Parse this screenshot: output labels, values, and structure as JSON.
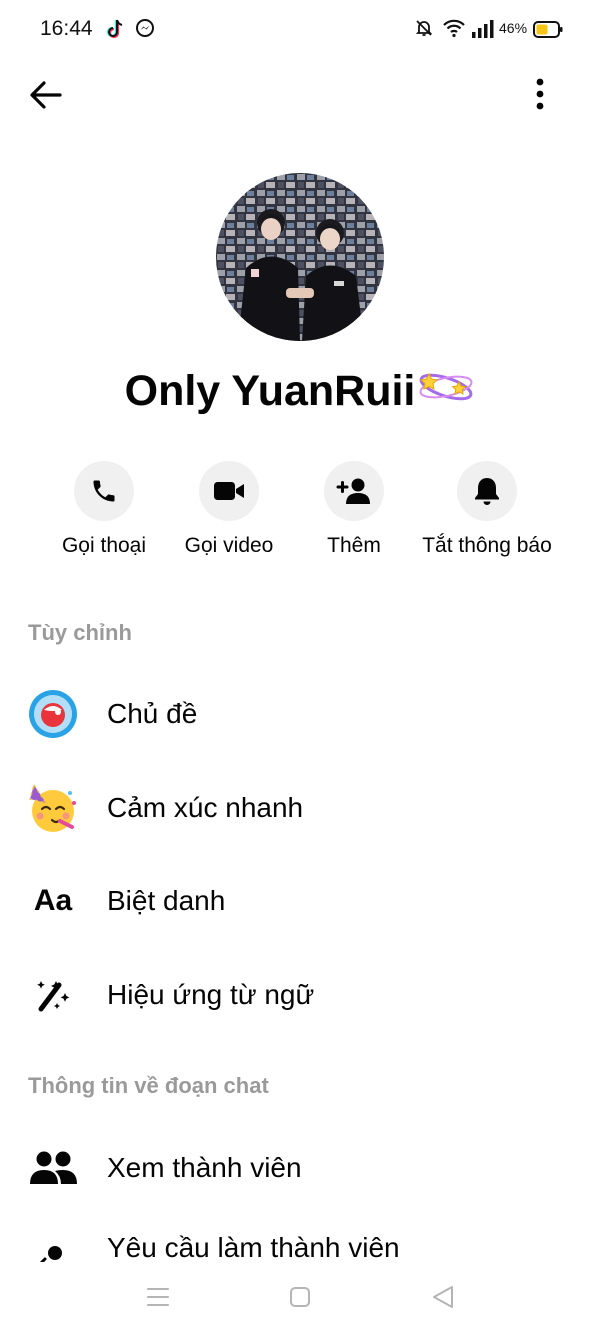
{
  "status_bar": {
    "time": "16:44",
    "battery_percent": "46%",
    "icons": [
      "tiktok-icon",
      "messenger-icon",
      "mute-bell-icon",
      "wifi-icon",
      "signal-icon",
      "battery-icon"
    ]
  },
  "header": {
    "back_icon": "arrow-left-icon",
    "more_icon": "more-vertical-icon"
  },
  "profile": {
    "name": "Only YuanRuii",
    "name_decoration": "sparkle-planet-emoji"
  },
  "actions": [
    {
      "label": "Gọi thoại",
      "icon": "phone-icon"
    },
    {
      "label": "Gọi video",
      "icon": "video-camera-icon"
    },
    {
      "label": "Thêm",
      "icon": "add-person-icon"
    },
    {
      "label": "Tắt thông báo",
      "icon": "bell-icon"
    }
  ],
  "customize_section": {
    "title": "Tùy chỉnh",
    "items": [
      {
        "label": "Chủ đề",
        "icon": "theme-icon"
      },
      {
        "label": "Cảm xúc nhanh",
        "icon": "party-face-emoji-icon"
      },
      {
        "label": "Biệt danh",
        "icon": "nickname-aa-icon"
      },
      {
        "label": "Hiệu ứng từ ngữ",
        "icon": "magic-wand-icon"
      }
    ]
  },
  "chat_info_section": {
    "title": "Thông tin về đoạn chat",
    "items": [
      {
        "label": "Xem thành viên",
        "icon": "people-icon"
      },
      {
        "label": "Yêu cầu làm thành viên",
        "icon": "person-request-icon"
      }
    ]
  },
  "nav_bar": {
    "buttons": [
      "menu-icon",
      "home-square-icon",
      "back-triangle-icon"
    ]
  },
  "colors": {
    "text": "#050505",
    "section_header": "#9a9a9a",
    "action_circle_bg": "#f0f0f0",
    "battery_fill": "#f5c518"
  }
}
